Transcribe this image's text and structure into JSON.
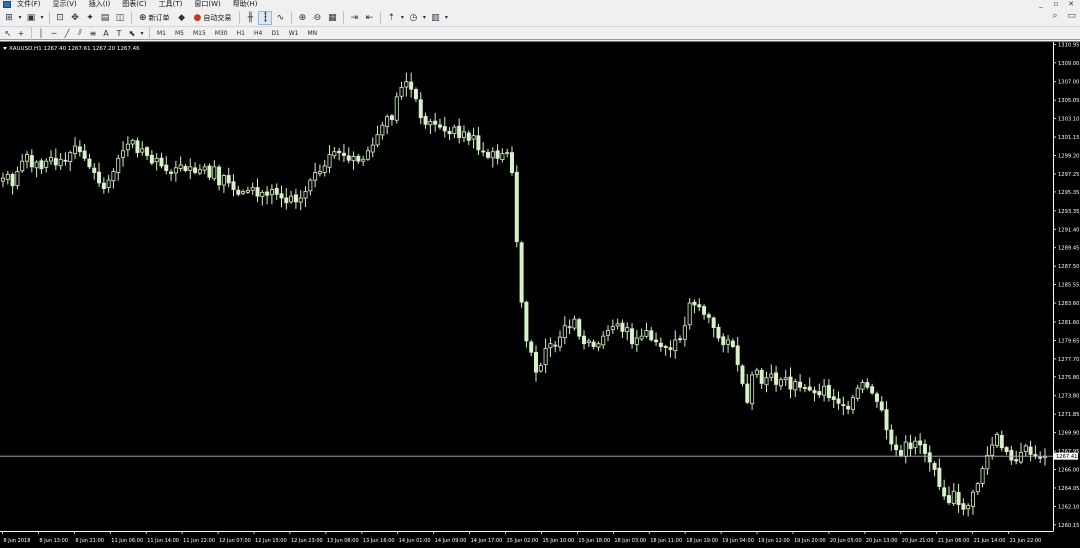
{
  "menu": {
    "items": [
      "文件(F)",
      "显示(V)",
      "插入(I)",
      "图表(C)",
      "工具(T)",
      "窗口(W)",
      "帮助(H)"
    ],
    "window_buttons": [
      "_",
      "▫",
      "✕"
    ]
  },
  "toolbar": {
    "new_order_label": "新订单",
    "auto_trading_label": "自动交易",
    "timeframes": [
      "M1",
      "M5",
      "M15",
      "M30",
      "H1",
      "H4",
      "D1",
      "W1",
      "MN"
    ],
    "active_timeframe": "H1"
  },
  "chart": {
    "header": "XAUUSD,H1  1267.40 1267.61 1267.20 1267.46",
    "current_price": "1267.41",
    "colors": {
      "background": "#000000",
      "candle": "#d6f2c8",
      "axis": "#ffffff",
      "price_line": "#b4b4b4"
    }
  },
  "chart_data": {
    "type": "candlestick",
    "symbol": "XAUUSD",
    "timeframe": "H1",
    "y_ticks": [
      "1310.95",
      "1309.00",
      "1307.00",
      "1305.05",
      "1303.10",
      "1301.15",
      "1299.20",
      "1297.25",
      "1295.35",
      "1293.35",
      "1291.40",
      "1289.45",
      "1287.50",
      "1285.55",
      "1283.60",
      "1281.60",
      "1279.65",
      "1277.70",
      "1275.80",
      "1273.80",
      "1271.85",
      "1269.90",
      "1267.95",
      "1266.00",
      "1264.05",
      "1262.10",
      "1260.15"
    ],
    "y_range": [
      1259.5,
      1311.2
    ],
    "x_ticks": [
      "8 Jun 2018",
      "8 Jun 13:00",
      "8 Jun 21:00",
      "11 Jun 06:00",
      "11 Jun 14:00",
      "11 Jun 22:00",
      "12 Jun 07:00",
      "12 Jun 15:00",
      "12 Jun 23:00",
      "13 Jun 08:00",
      "13 Jun 16:00",
      "14 Jun 01:00",
      "14 Jun 09:00",
      "14 Jun 17:00",
      "15 Jun 02:00",
      "15 Jun 10:00",
      "15 Jun 18:00",
      "18 Jun 03:00",
      "18 Jun 11:00",
      "18 Jun 19:00",
      "19 Jun 04:00",
      "19 Jun 12:00",
      "19 Jun 20:00",
      "20 Jun 05:00",
      "20 Jun 13:00",
      "20 Jun 21:00",
      "21 Jun 06:00",
      "21 Jun 14:00",
      "21 Jun 22:00"
    ],
    "current_price": 1267.41,
    "close_path": [
      1296.8,
      1297.2,
      1296.0,
      1297.5,
      1298.6,
      1299.3,
      1298.0,
      1298.5,
      1297.8,
      1298.6,
      1299.0,
      1298.2,
      1298.8,
      1298.6,
      1299.5,
      1300.2,
      1299.6,
      1298.9,
      1298.0,
      1297.4,
      1296.3,
      1295.7,
      1296.6,
      1297.5,
      1298.9,
      1299.7,
      1300.4,
      1300.8,
      1299.5,
      1299.9,
      1299.2,
      1298.4,
      1298.9,
      1298.1,
      1297.6,
      1297.3,
      1297.9,
      1298.2,
      1297.6,
      1298.0,
      1297.4,
      1297.7,
      1298.0,
      1296.9,
      1298.0,
      1296.1,
      1297.1,
      1296.3,
      1295.6,
      1295.1,
      1295.4,
      1295.5,
      1295.8,
      1294.9,
      1295.3,
      1295.0,
      1295.6,
      1295.1,
      1294.7,
      1294.2,
      1294.9,
      1294.3,
      1294.7,
      1295.4,
      1296.6,
      1297.4,
      1297.5,
      1298.1,
      1299.3,
      1299.6,
      1299.5,
      1299.2,
      1298.7,
      1299.1,
      1298.6,
      1298.8,
      1299.7,
      1300.3,
      1301.4,
      1302.4,
      1303.3,
      1303.0,
      1305.4,
      1306.4,
      1307.0,
      1306.2,
      1305.2,
      1303.2,
      1302.5,
      1302.8,
      1302.5,
      1302.2,
      1301.8,
      1301.5,
      1302.2,
      1301.1,
      1301.7,
      1300.8,
      1301.3,
      1299.8,
      1299.6,
      1299.0,
      1299.6,
      1298.9,
      1299.4,
      1299.5,
      1297.4,
      1290.1,
      1283.7,
      1279.6,
      1278.4,
      1276.3,
      1277.0,
      1278.8,
      1279.3,
      1279.1,
      1280.0,
      1281.2,
      1281.1,
      1281.9,
      1280.1,
      1279.3,
      1279.6,
      1279.0,
      1279.3,
      1280.1,
      1280.7,
      1281.1,
      1281.4,
      1280.6,
      1281.0,
      1279.3,
      1279.9,
      1280.1,
      1280.7,
      1279.7,
      1279.5,
      1279.0,
      1278.9,
      1278.7,
      1279.7,
      1279.8,
      1281.2,
      1283.6,
      1283.4,
      1283.2,
      1282.4,
      1282.1,
      1281.0,
      1279.9,
      1279.2,
      1279.7,
      1279.0,
      1277.1,
      1275.1,
      1273.1,
      1276.0,
      1276.5,
      1275.1,
      1275.7,
      1276.1,
      1275.0,
      1275.5,
      1275.7,
      1274.5,
      1275.3,
      1274.7,
      1274.6,
      1274.4,
      1274.1,
      1273.9,
      1274.8,
      1273.6,
      1273.4,
      1273.0,
      1272.8,
      1272.4,
      1273.6,
      1274.6,
      1275.2,
      1274.7,
      1274.1,
      1273.2,
      1272.3,
      1270.2,
      1268.7,
      1268.1,
      1267.5,
      1268.9,
      1268.2,
      1269.0,
      1268.6,
      1267.7,
      1266.8,
      1266.0,
      1264.2,
      1263.2,
      1262.5,
      1263.7,
      1262.3,
      1261.8,
      1262.2,
      1263.6,
      1264.5,
      1266.1,
      1267.5,
      1268.6,
      1269.7,
      1268.3,
      1267.9,
      1267.0,
      1266.9,
      1267.8,
      1268.5,
      1267.6,
      1267.4,
      1267.2,
      1267.4
    ]
  }
}
